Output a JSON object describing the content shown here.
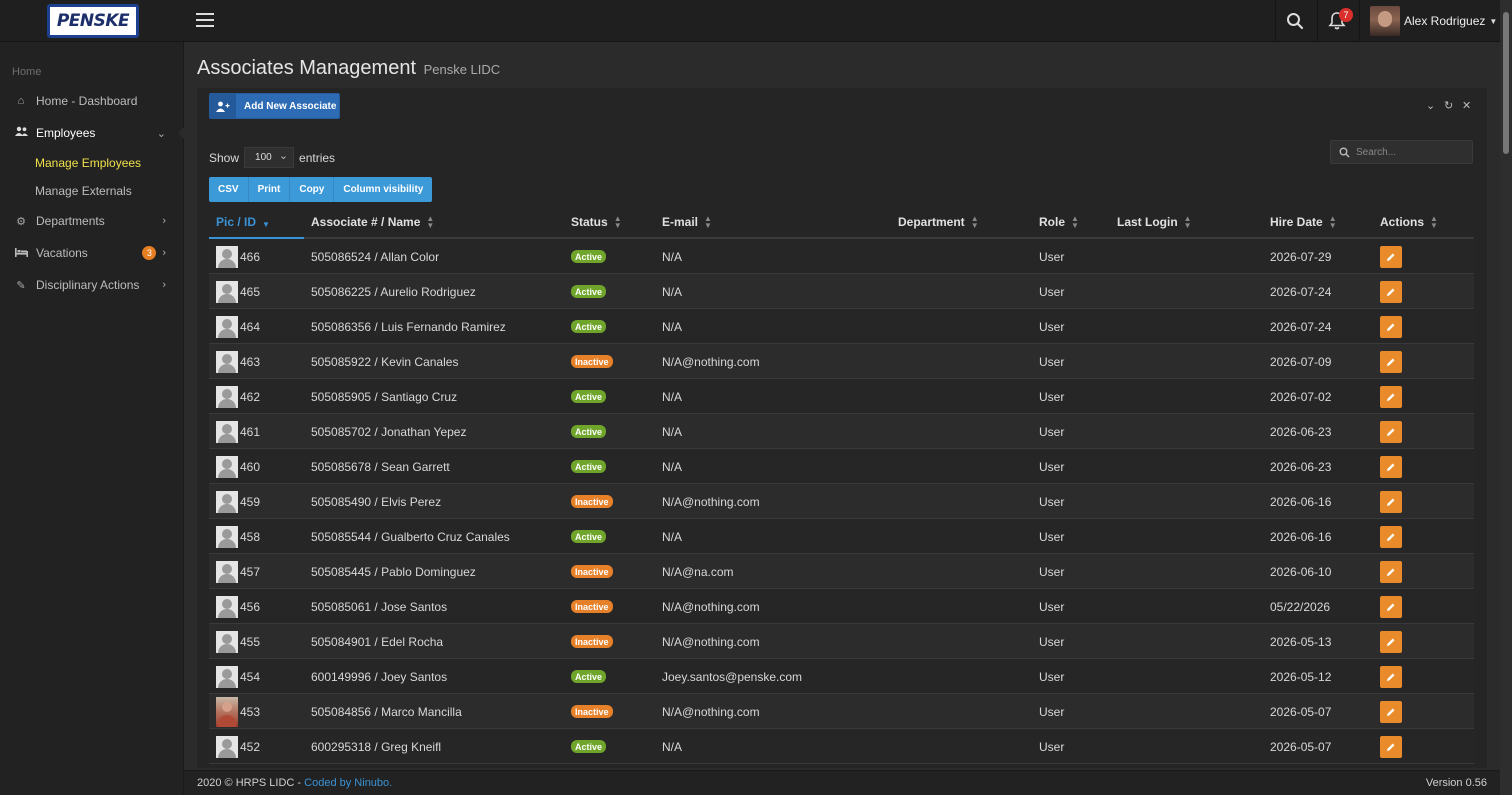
{
  "header": {
    "logo_text": "PENSKE",
    "notification_count": "7",
    "user_name": "Alex Rodriguez"
  },
  "sidebar": {
    "section_label": "Home",
    "items": [
      {
        "label": "Home - Dashboard"
      },
      {
        "label": "Employees"
      },
      {
        "label": "Departments"
      },
      {
        "label": "Vacations",
        "badge": "3"
      },
      {
        "label": "Disciplinary Actions"
      }
    ],
    "sub_items": [
      {
        "label": "Manage Employees"
      },
      {
        "label": "Manage Externals"
      }
    ]
  },
  "page": {
    "title": "Associates Management",
    "subtitle": "Penske LIDC"
  },
  "panel": {
    "add_button": "Add New Associate",
    "show_label": "Show",
    "entries_value": "100",
    "entries_label": "entries",
    "search_placeholder": "Search...",
    "export_buttons": [
      "CSV",
      "Print",
      "Copy",
      "Column visibility"
    ]
  },
  "table": {
    "columns": [
      "Pic / ID",
      "Associate # / Name",
      "Status",
      "E-mail",
      "Department",
      "Role",
      "Last Login",
      "Hire Date",
      "Actions"
    ],
    "rows": [
      {
        "id": "466",
        "name": "505086524 / Allan Color",
        "status": "Active",
        "email": "N/A",
        "department": "",
        "role": "User",
        "last_login": "",
        "hire_date": "2026-07-29"
      },
      {
        "id": "465",
        "name": "505086225 / Aurelio Rodriguez",
        "status": "Active",
        "email": "N/A",
        "department": "",
        "role": "User",
        "last_login": "",
        "hire_date": "2026-07-24"
      },
      {
        "id": "464",
        "name": "505086356 / Luis Fernando Ramirez",
        "status": "Active",
        "email": "N/A",
        "department": "",
        "role": "User",
        "last_login": "",
        "hire_date": "2026-07-24"
      },
      {
        "id": "463",
        "name": "505085922 / Kevin Canales",
        "status": "Inactive",
        "email": "N/A@nothing.com",
        "department": "",
        "role": "User",
        "last_login": "",
        "hire_date": "2026-07-09"
      },
      {
        "id": "462",
        "name": "505085905 / Santiago Cruz",
        "status": "Active",
        "email": "N/A",
        "department": "",
        "role": "User",
        "last_login": "",
        "hire_date": "2026-07-02"
      },
      {
        "id": "461",
        "name": "505085702 / Jonathan Yepez",
        "status": "Active",
        "email": "N/A",
        "department": "",
        "role": "User",
        "last_login": "",
        "hire_date": "2026-06-23"
      },
      {
        "id": "460",
        "name": "505085678 / Sean Garrett",
        "status": "Active",
        "email": "N/A",
        "department": "",
        "role": "User",
        "last_login": "",
        "hire_date": "2026-06-23"
      },
      {
        "id": "459",
        "name": "505085490 / Elvis Perez",
        "status": "Inactive",
        "email": "N/A@nothing.com",
        "department": "",
        "role": "User",
        "last_login": "",
        "hire_date": "2026-06-16"
      },
      {
        "id": "458",
        "name": "505085544 / Gualberto Cruz Canales",
        "status": "Active",
        "email": "N/A",
        "department": "",
        "role": "User",
        "last_login": "",
        "hire_date": "2026-06-16"
      },
      {
        "id": "457",
        "name": "505085445 / Pablo Dominguez",
        "status": "Inactive",
        "email": "N/A@na.com",
        "department": "",
        "role": "User",
        "last_login": "",
        "hire_date": "2026-06-10"
      },
      {
        "id": "456",
        "name": "505085061 / Jose Santos",
        "status": "Inactive",
        "email": "N/A@nothing.com",
        "department": "",
        "role": "User",
        "last_login": "",
        "hire_date": "05/22/2026"
      },
      {
        "id": "455",
        "name": "505084901 / Edel Rocha",
        "status": "Inactive",
        "email": "N/A@nothing.com",
        "department": "",
        "role": "User",
        "last_login": "",
        "hire_date": "2026-05-13"
      },
      {
        "id": "454",
        "name": "600149996 / Joey Santos",
        "status": "Active",
        "email": "Joey.santos@penske.com",
        "department": "",
        "role": "User",
        "last_login": "",
        "hire_date": "2026-05-12"
      },
      {
        "id": "453",
        "name": "505084856 / Marco Mancilla",
        "status": "Inactive",
        "email": "N/A@nothing.com",
        "department": "",
        "role": "User",
        "last_login": "",
        "hire_date": "2026-05-07",
        "photo": true
      },
      {
        "id": "452",
        "name": "600295318 / Greg Kneifl",
        "status": "Active",
        "email": "N/A",
        "department": "",
        "role": "User",
        "last_login": "",
        "hire_date": "2026-05-07"
      }
    ]
  },
  "footer": {
    "copyright": "2020 © HRPS LIDC - ",
    "coded_by": "Coded by Ninubo.",
    "version": "Version 0.56"
  },
  "colors": {
    "accent_blue": "#3a93d6",
    "active_green": "#6fa52a",
    "inactive_orange": "#e6812a",
    "edit_orange": "#e98b2a",
    "current_menu_yellow": "#f0e04a"
  }
}
